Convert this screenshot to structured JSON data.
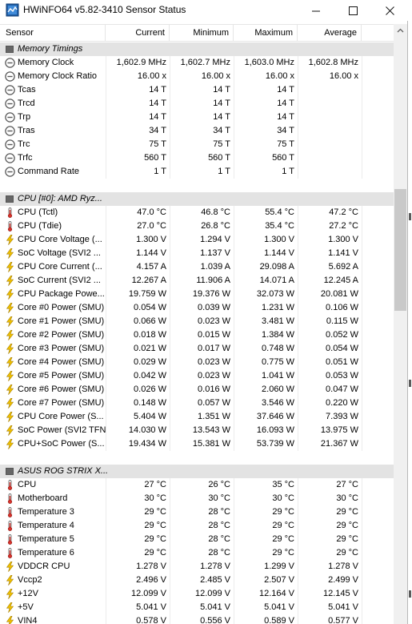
{
  "window": {
    "title": "HWiNFO64 v5.82-3410 Sensor Status",
    "minimize_glyph": "—",
    "maximize_glyph": "☐",
    "close_glyph": "✕"
  },
  "columns": {
    "sensor": "Sensor",
    "current": "Current",
    "minimum": "Minimum",
    "maximum": "Maximum",
    "average": "Average"
  },
  "colors": {
    "group_row": "#e3e3e3",
    "thermo_red": "#d8322b",
    "bolt_yellow": "#e8b800",
    "clock_gray": "#606060"
  },
  "rows": [
    {
      "type": "group",
      "name": "Memory Timings"
    },
    {
      "type": "sensor",
      "icon": "clock-icon",
      "name": "Memory Clock",
      "current": "1,602.9 MHz",
      "minimum": "1,602.7 MHz",
      "maximum": "1,603.0 MHz",
      "average": "1,602.8 MHz"
    },
    {
      "type": "sensor",
      "icon": "clock-icon",
      "name": "Memory Clock Ratio",
      "current": "16.00 x",
      "minimum": "16.00 x",
      "maximum": "16.00 x",
      "average": "16.00 x"
    },
    {
      "type": "sensor",
      "icon": "clock-icon",
      "name": "Tcas",
      "current": "14 T",
      "minimum": "14 T",
      "maximum": "14 T",
      "average": ""
    },
    {
      "type": "sensor",
      "icon": "clock-icon",
      "name": "Trcd",
      "current": "14 T",
      "minimum": "14 T",
      "maximum": "14 T",
      "average": ""
    },
    {
      "type": "sensor",
      "icon": "clock-icon",
      "name": "Trp",
      "current": "14 T",
      "minimum": "14 T",
      "maximum": "14 T",
      "average": ""
    },
    {
      "type": "sensor",
      "icon": "clock-icon",
      "name": "Tras",
      "current": "34 T",
      "minimum": "34 T",
      "maximum": "34 T",
      "average": ""
    },
    {
      "type": "sensor",
      "icon": "clock-icon",
      "name": "Trc",
      "current": "75 T",
      "minimum": "75 T",
      "maximum": "75 T",
      "average": ""
    },
    {
      "type": "sensor",
      "icon": "clock-icon",
      "name": "Trfc",
      "current": "560 T",
      "minimum": "560 T",
      "maximum": "560 T",
      "average": ""
    },
    {
      "type": "sensor",
      "icon": "clock-icon",
      "name": "Command Rate",
      "current": "1 T",
      "minimum": "1 T",
      "maximum": "1 T",
      "average": ""
    },
    {
      "type": "blank"
    },
    {
      "type": "group",
      "name": "CPU [#0]: AMD Ryz..."
    },
    {
      "type": "sensor",
      "icon": "thermometer-icon",
      "name": "CPU (Tctl)",
      "current": "47.0 °C",
      "minimum": "46.8 °C",
      "maximum": "55.4 °C",
      "average": "47.2 °C"
    },
    {
      "type": "sensor",
      "icon": "thermometer-icon",
      "name": "CPU (Tdie)",
      "current": "27.0 °C",
      "minimum": "26.8 °C",
      "maximum": "35.4 °C",
      "average": "27.2 °C"
    },
    {
      "type": "sensor",
      "icon": "lightning-icon",
      "name": "CPU Core Voltage (...",
      "current": "1.300 V",
      "minimum": "1.294 V",
      "maximum": "1.300 V",
      "average": "1.300 V"
    },
    {
      "type": "sensor",
      "icon": "lightning-icon",
      "name": "SoC Voltage (SVI2 ...",
      "current": "1.144 V",
      "minimum": "1.137 V",
      "maximum": "1.144 V",
      "average": "1.141 V"
    },
    {
      "type": "sensor",
      "icon": "lightning-icon",
      "name": "CPU Core Current (...",
      "current": "4.157 A",
      "minimum": "1.039 A",
      "maximum": "29.098 A",
      "average": "5.692 A"
    },
    {
      "type": "sensor",
      "icon": "lightning-icon",
      "name": "SoC Current (SVI2 ...",
      "current": "12.267 A",
      "minimum": "11.906 A",
      "maximum": "14.071 A",
      "average": "12.245 A"
    },
    {
      "type": "sensor",
      "icon": "lightning-icon",
      "name": "CPU Package Powe...",
      "current": "19.759 W",
      "minimum": "19.376 W",
      "maximum": "32.073 W",
      "average": "20.081 W"
    },
    {
      "type": "sensor",
      "icon": "lightning-icon",
      "name": "Core #0 Power (SMU)",
      "current": "0.054 W",
      "minimum": "0.039 W",
      "maximum": "1.231 W",
      "average": "0.106 W"
    },
    {
      "type": "sensor",
      "icon": "lightning-icon",
      "name": "Core #1 Power (SMU)",
      "current": "0.066 W",
      "minimum": "0.023 W",
      "maximum": "3.481 W",
      "average": "0.115 W"
    },
    {
      "type": "sensor",
      "icon": "lightning-icon",
      "name": "Core #2 Power (SMU)",
      "current": "0.018 W",
      "minimum": "0.015 W",
      "maximum": "1.384 W",
      "average": "0.052 W"
    },
    {
      "type": "sensor",
      "icon": "lightning-icon",
      "name": "Core #3 Power (SMU)",
      "current": "0.021 W",
      "minimum": "0.017 W",
      "maximum": "0.748 W",
      "average": "0.054 W"
    },
    {
      "type": "sensor",
      "icon": "lightning-icon",
      "name": "Core #4 Power (SMU)",
      "current": "0.029 W",
      "minimum": "0.023 W",
      "maximum": "0.775 W",
      "average": "0.051 W"
    },
    {
      "type": "sensor",
      "icon": "lightning-icon",
      "name": "Core #5 Power (SMU)",
      "current": "0.042 W",
      "minimum": "0.023 W",
      "maximum": "1.041 W",
      "average": "0.053 W"
    },
    {
      "type": "sensor",
      "icon": "lightning-icon",
      "name": "Core #6 Power (SMU)",
      "current": "0.026 W",
      "minimum": "0.016 W",
      "maximum": "2.060 W",
      "average": "0.047 W"
    },
    {
      "type": "sensor",
      "icon": "lightning-icon",
      "name": "Core #7 Power (SMU)",
      "current": "0.148 W",
      "minimum": "0.057 W",
      "maximum": "3.546 W",
      "average": "0.220 W"
    },
    {
      "type": "sensor",
      "icon": "lightning-icon",
      "name": "CPU Core Power (S...",
      "current": "5.404 W",
      "minimum": "1.351 W",
      "maximum": "37.646 W",
      "average": "7.393 W"
    },
    {
      "type": "sensor",
      "icon": "lightning-icon",
      "name": "SoC Power (SVI2 TFN)",
      "current": "14.030 W",
      "minimum": "13.543 W",
      "maximum": "16.093 W",
      "average": "13.975 W"
    },
    {
      "type": "sensor",
      "icon": "lightning-icon",
      "name": "CPU+SoC Power (S...",
      "current": "19.434 W",
      "minimum": "15.381 W",
      "maximum": "53.739 W",
      "average": "21.367 W"
    },
    {
      "type": "blank"
    },
    {
      "type": "group",
      "name": "ASUS ROG STRIX X..."
    },
    {
      "type": "sensor",
      "icon": "thermometer-icon",
      "name": "CPU",
      "current": "27 °C",
      "minimum": "26 °C",
      "maximum": "35 °C",
      "average": "27 °C"
    },
    {
      "type": "sensor",
      "icon": "thermometer-icon",
      "name": "Motherboard",
      "current": "30 °C",
      "minimum": "30 °C",
      "maximum": "30 °C",
      "average": "30 °C"
    },
    {
      "type": "sensor",
      "icon": "thermometer-icon",
      "name": "Temperature 3",
      "current": "29 °C",
      "minimum": "28 °C",
      "maximum": "29 °C",
      "average": "29 °C"
    },
    {
      "type": "sensor",
      "icon": "thermometer-icon",
      "name": "Temperature 4",
      "current": "29 °C",
      "minimum": "28 °C",
      "maximum": "29 °C",
      "average": "29 °C"
    },
    {
      "type": "sensor",
      "icon": "thermometer-icon",
      "name": "Temperature 5",
      "current": "29 °C",
      "minimum": "28 °C",
      "maximum": "29 °C",
      "average": "29 °C"
    },
    {
      "type": "sensor",
      "icon": "thermometer-icon",
      "name": "Temperature 6",
      "current": "29 °C",
      "minimum": "28 °C",
      "maximum": "29 °C",
      "average": "29 °C"
    },
    {
      "type": "sensor",
      "icon": "lightning-icon",
      "name": "VDDCR CPU",
      "current": "1.278 V",
      "minimum": "1.278 V",
      "maximum": "1.299 V",
      "average": "1.278 V"
    },
    {
      "type": "sensor",
      "icon": "lightning-icon",
      "name": "Vccp2",
      "current": "2.496 V",
      "minimum": "2.485 V",
      "maximum": "2.507 V",
      "average": "2.499 V"
    },
    {
      "type": "sensor",
      "icon": "lightning-icon",
      "name": "+12V",
      "current": "12.099 V",
      "minimum": "12.099 V",
      "maximum": "12.164 V",
      "average": "12.145 V"
    },
    {
      "type": "sensor",
      "icon": "lightning-icon",
      "name": "+5V",
      "current": "5.041 V",
      "minimum": "5.041 V",
      "maximum": "5.041 V",
      "average": "5.041 V"
    },
    {
      "type": "sensor",
      "icon": "lightning-icon",
      "name": "VIN4",
      "current": "0.578 V",
      "minimum": "0.556 V",
      "maximum": "0.589 V",
      "average": "0.577 V"
    }
  ]
}
